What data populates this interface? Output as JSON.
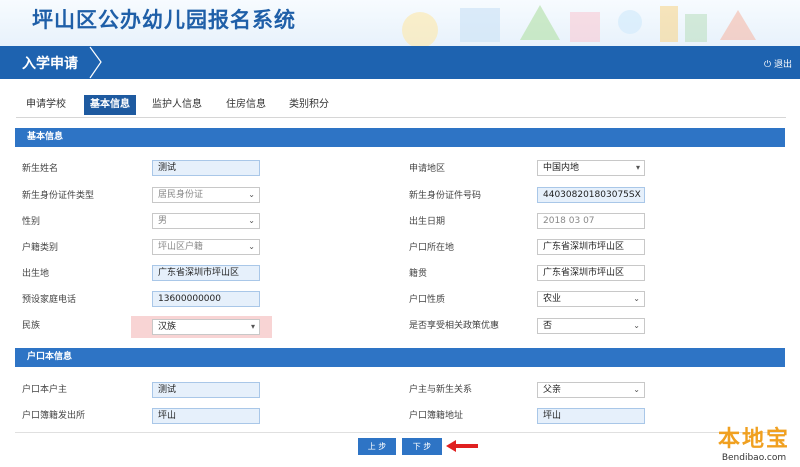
{
  "app_title": "坪山区公办幼儿园报名系统",
  "nav": {
    "label": "入学申请",
    "logout": "退出"
  },
  "tabs": [
    "申请学校",
    "基本信息",
    "监护人信息",
    "住房信息",
    "类别积分"
  ],
  "section_basic": "基本信息",
  "section_hukou": "户口本信息",
  "basic_left": [
    {
      "label": "新生姓名",
      "value": "测试"
    },
    {
      "label": "新生身份证件类型",
      "value": "居民身份证"
    },
    {
      "label": "性别",
      "value": "男"
    },
    {
      "label": "户籍类别",
      "value": "坪山区户籍"
    },
    {
      "label": "出生地",
      "value": "广东省深圳市坪山区"
    },
    {
      "label": "预设家庭电话",
      "value": "13600000000"
    },
    {
      "label": "民族",
      "value": "汉族"
    }
  ],
  "basic_right": [
    {
      "label": "申请地区",
      "value": "中国内地"
    },
    {
      "label": "新生身份证件号码",
      "value": "440308201803075SX"
    },
    {
      "label": "出生日期",
      "value": "2018 03 07"
    },
    {
      "label": "户口所在地",
      "value": "广东省深圳市坪山区"
    },
    {
      "label": "籍贯",
      "value": "广东省深圳市坪山区"
    },
    {
      "label": "户口性质",
      "value": "农业"
    },
    {
      "label": "是否享受相关政策优惠",
      "value": "否"
    }
  ],
  "hukou_left": [
    {
      "label": "户口本户主",
      "value": "测试"
    },
    {
      "label": "户口簿籍发出所",
      "value": "坪山"
    }
  ],
  "hukou_right": [
    {
      "label": "户主与新生关系",
      "value": "父亲"
    },
    {
      "label": "户口簿籍地址",
      "value": "坪山"
    }
  ],
  "buttons": {
    "prev": "上 步",
    "next": "下 步"
  },
  "watermark": {
    "cn": "本地宝",
    "en": "Bendibao.com"
  }
}
